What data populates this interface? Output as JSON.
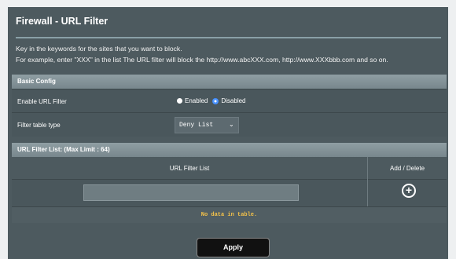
{
  "page": {
    "title": "Firewall - URL Filter",
    "description_line1": "Key in the keywords for the sites that you want to block.",
    "description_line2": "For example, enter \"XXX\" in the list The URL filter will block the http://www.abcXXX.com, http://www.XXXbbb.com and so on."
  },
  "basic_config": {
    "header": "Basic Config",
    "enable_label": "Enable URL Filter",
    "enable_options": [
      "Enabled",
      "Disabled"
    ],
    "enable_selected": "Disabled",
    "filter_type_label": "Filter table type",
    "filter_type_value": "Deny List"
  },
  "url_list": {
    "header": "URL Filter List: (Max Limit : 64)",
    "col_url": "URL Filter List",
    "col_action": "Add / Delete",
    "input_value": "",
    "empty_message": "No data in table."
  },
  "actions": {
    "apply_label": "Apply"
  },
  "icons": {
    "add": "plus-circle-icon",
    "dropdown": "chevron-down-icon"
  },
  "colors": {
    "panel_bg": "#4d5a5f",
    "section_header": "#84939a",
    "empty_message": "#f4c24a",
    "radio_selected": "#3f8cff"
  }
}
